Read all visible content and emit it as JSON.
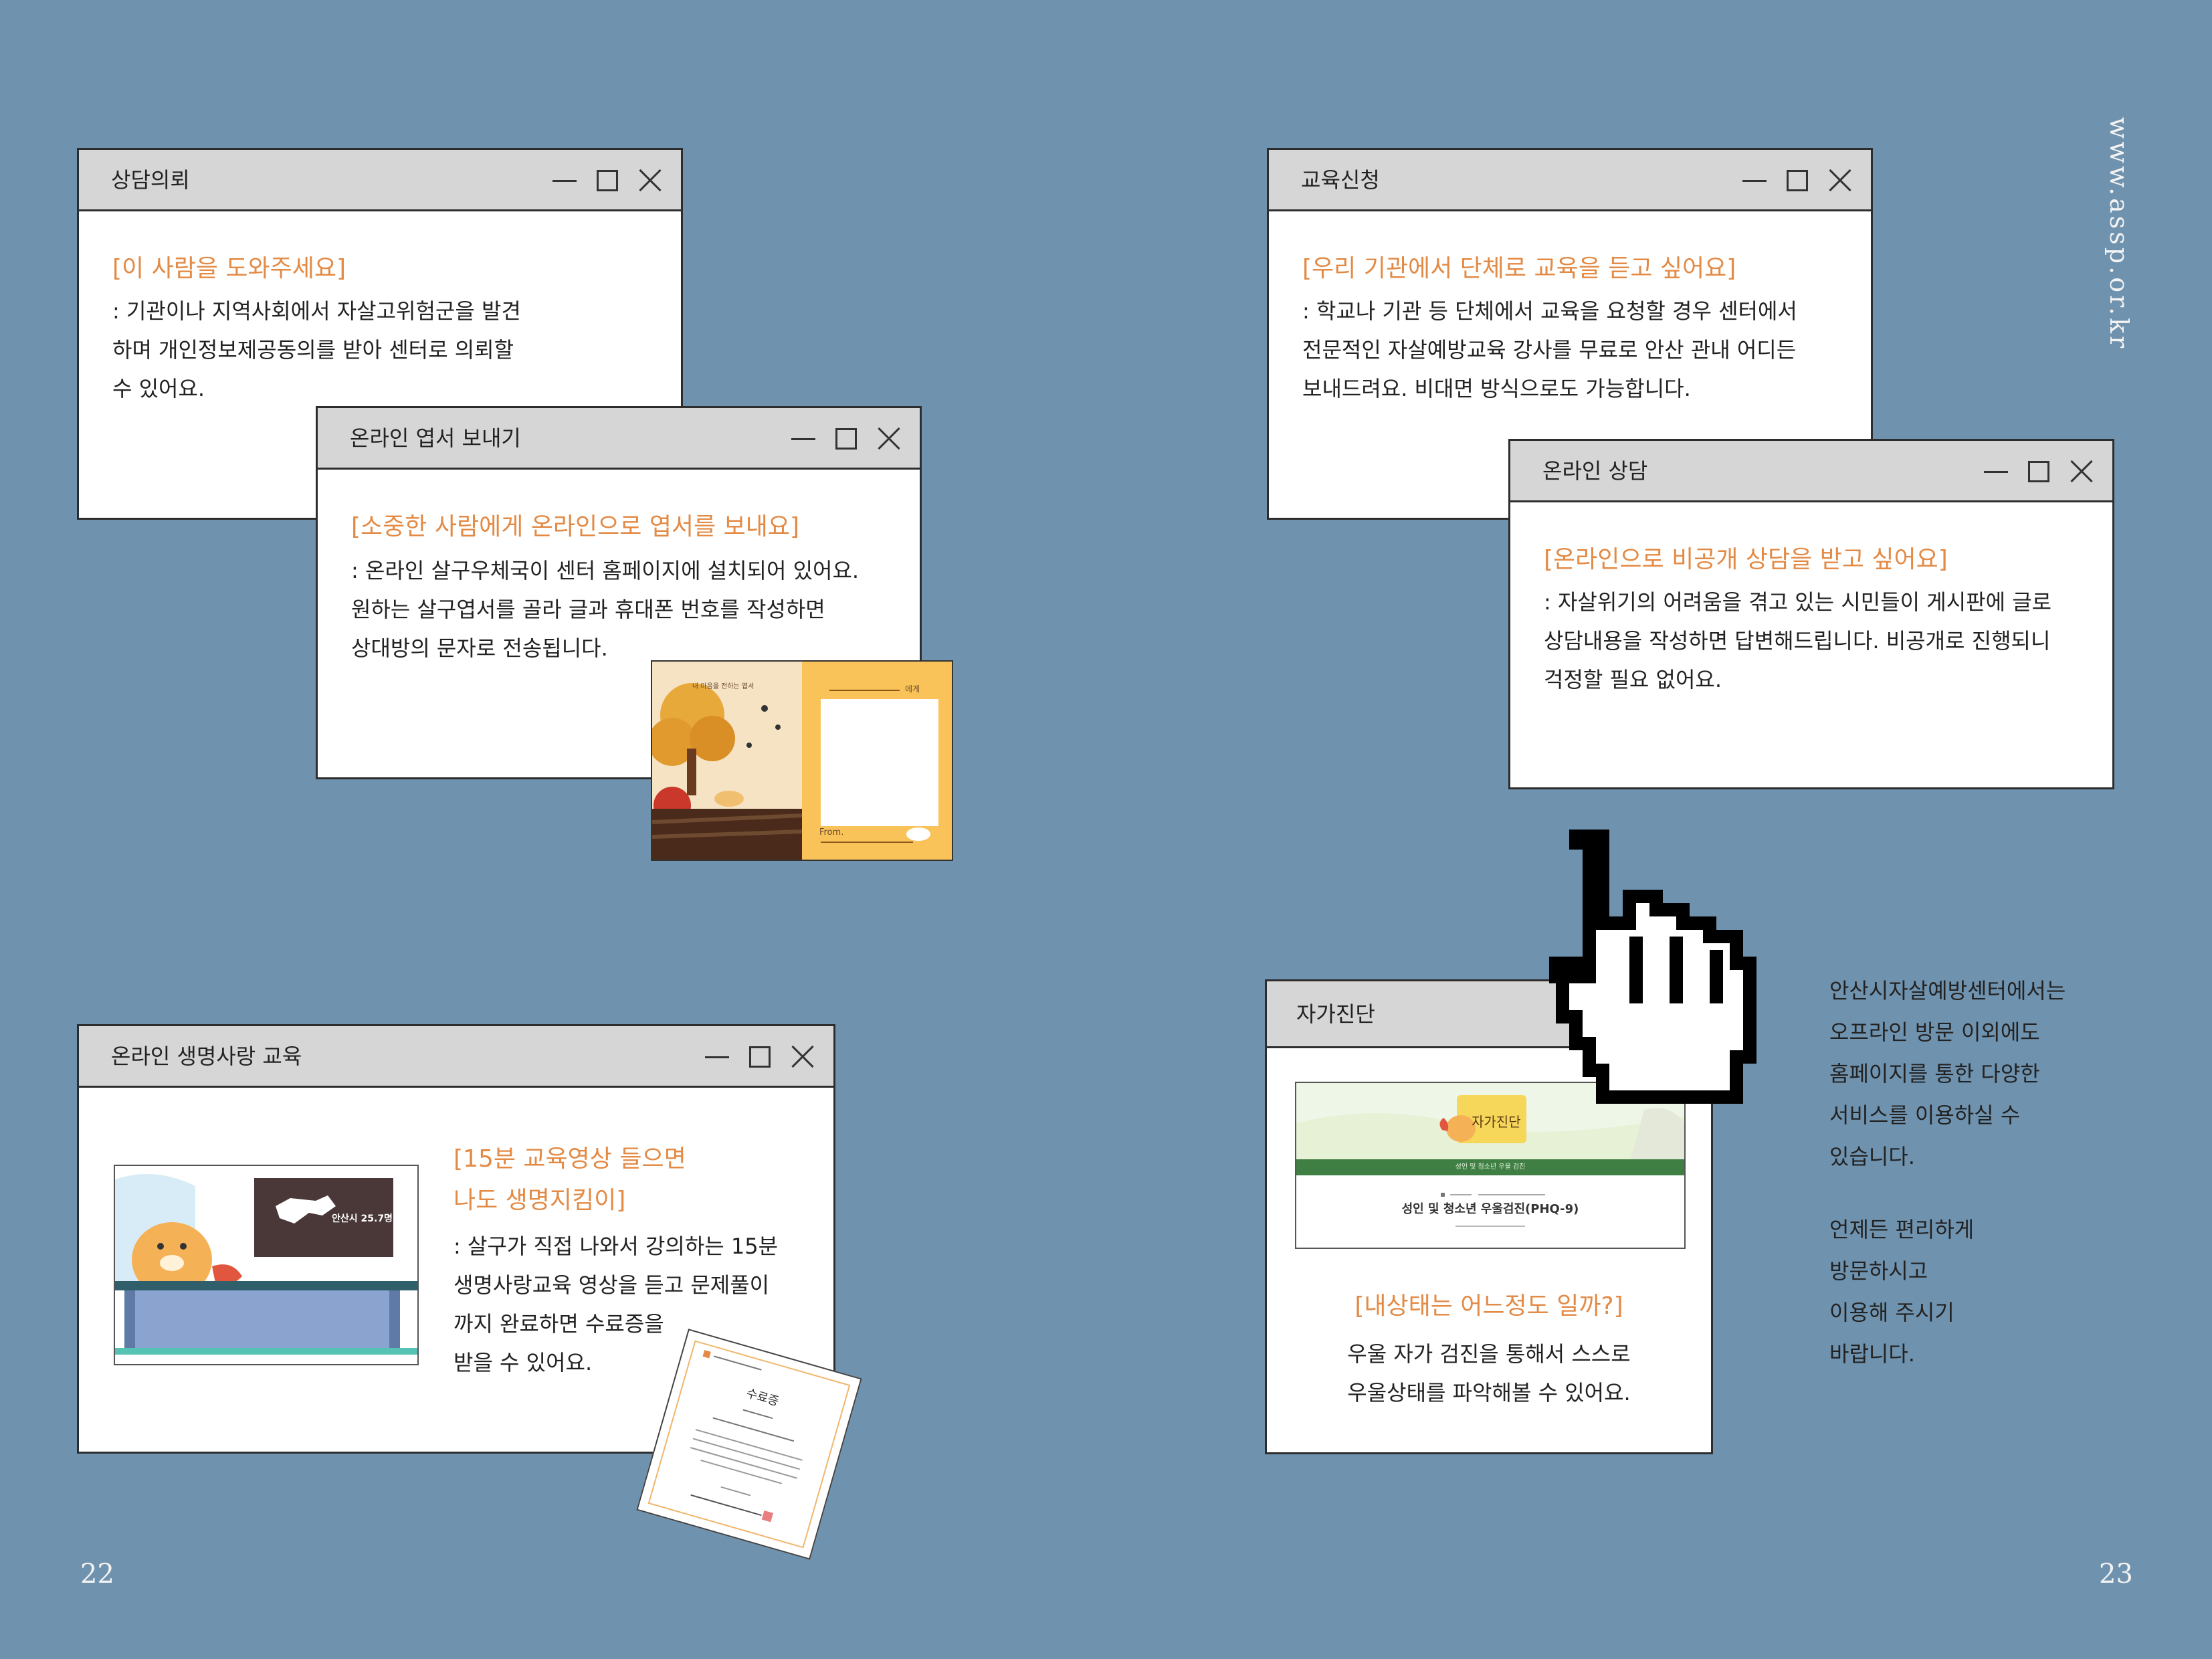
{
  "windows": {
    "consult": {
      "title": "상담의뢰",
      "headline": "[이 사람을 도와주세요]",
      "lines": [
        ": 기관이나 지역사회에서 자살고위험군을 발견",
        "하며 개인정보제공동의를 받아 센터로 의뢰할",
        "수 있어요."
      ]
    },
    "postcard": {
      "title": "온라인 엽서 보내기",
      "headline": "[소중한 사람에게 온라인으로 엽서를 보내요]",
      "lines": [
        ": 온라인 살구우체국이 센터 홈페이지에 설치되어 있어요.",
        "원하는 살구엽서를 골라 글과 휴대폰 번호를 작성하면",
        "상대방의 문자로 전송됩니다."
      ],
      "card_to": "에게",
      "card_from": "From.",
      "card_caption": "내 마음을 전하는 엽서"
    },
    "education": {
      "title": "교육신청",
      "headline": "[우리 기관에서 단체로 교육을 듣고 싶어요]",
      "lines": [
        ": 학교나 기관 등 단체에서 교육을 요청할 경우 센터에서",
        "전문적인 자살예방교육 강사를 무료로 안산 관내 어디든",
        "보내드려요. 비대면 방식으로도 가능합니다."
      ]
    },
    "online_counsel": {
      "title": "온라인 상담",
      "headline": "[온라인으로 비공개 상담을 받고 싶어요]",
      "lines": [
        ": 자살위기의 어려움을 겪고 있는 시민들이 게시판에 글로",
        "상담내용을 작성하면 답변해드립니다. 비공개로 진행되니",
        "걱정할 필요 없어요."
      ]
    },
    "life_edu": {
      "title": "온라인 생명사랑 교육",
      "headline_lines": [
        "[15분 교육영상 들으면",
        "나도 생명지킴이]"
      ],
      "lines": [
        ": 살구가 직접 나와서 강의하는 15분",
        "생명사랑교육 영상을 듣고 문제풀이",
        "까지 완료하면 수료증을",
        "받을 수 있어요."
      ],
      "screen_text": "안산시 25.7명",
      "certificate_title": "수료증"
    },
    "self_check": {
      "title": "자가진단",
      "headline": "[내상태는 어느정도 일까?]",
      "lines": [
        "우울 자가 검진을 통해서 스스로",
        "우울상태를 파악해볼 수 있어요."
      ],
      "banner_logo": "자가진단",
      "banner_bar": "성인 및 청소년 우울 검진",
      "banner_title": "성인 및 청소년 우울검진(PHQ-9)"
    }
  },
  "side_text": {
    "para1": [
      "안산시자살예방센터에서는",
      "오프라인 방문 이외에도",
      "홈페이지를 통한 다양한",
      "서비스를 이용하실 수",
      "있습니다."
    ],
    "para2": [
      "언제든 편리하게",
      "방문하시고",
      "이용해 주시기",
      "바랍니다."
    ]
  },
  "url": "www.assp.or.kr",
  "page_left": "22",
  "page_right": "23",
  "colors": {
    "background": "#6f92ae",
    "accent": "#e38a45",
    "titlebar": "#d6d6d6"
  }
}
